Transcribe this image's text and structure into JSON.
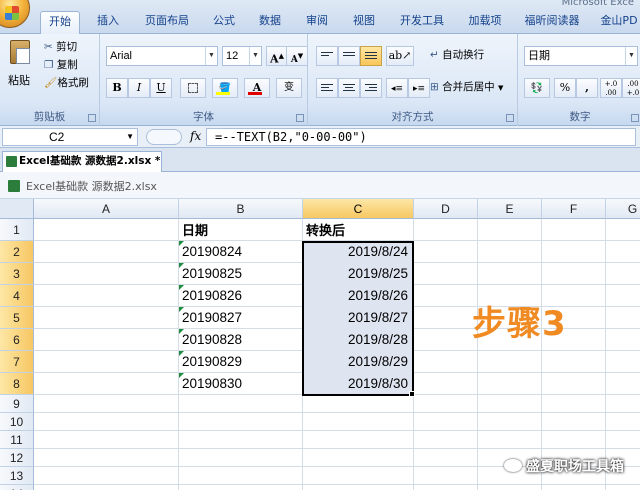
{
  "titlebar": {
    "app_title": "Microsoft Exce"
  },
  "ribbon_tabs": [
    {
      "label": "开始",
      "active": true
    },
    {
      "label": "插入"
    },
    {
      "label": "页面布局"
    },
    {
      "label": "公式"
    },
    {
      "label": "数据"
    },
    {
      "label": "审阅"
    },
    {
      "label": "视图"
    },
    {
      "label": "开发工具"
    },
    {
      "label": "加载项"
    },
    {
      "label": "福昕阅读器"
    },
    {
      "label": "金山PD"
    }
  ],
  "clipboard": {
    "paste": "粘贴",
    "cut": "剪切",
    "copy": "复制",
    "format_painter": "格式刷",
    "group": "剪贴板"
  },
  "font": {
    "name": "Arial",
    "size": "12",
    "grow": "A",
    "shrink": "A",
    "bold": "B",
    "italic": "I",
    "underline": "U",
    "font_color": "A",
    "phonetic": "变",
    "group": "字体"
  },
  "alignment": {
    "wrap_text": "自动换行",
    "merge_center": "合并后居中",
    "group": "对齐方式"
  },
  "number": {
    "format": "日期",
    "percent": "%",
    "comma": ",",
    "inc_decimal": "+.0 .00",
    "dec_decimal": ".00 +.0",
    "group": "数字"
  },
  "formula_bar": {
    "cell_ref": "C2",
    "fx": "fx",
    "formula": "=--TEXT(B2,\"0-00-00\")"
  },
  "workbook": {
    "tab_title": "Excel基础款 源数据2.xlsx *",
    "window_title": "Excel基础款 源数据2.xlsx"
  },
  "grid": {
    "columns": [
      "A",
      "B",
      "C",
      "D",
      "E",
      "F",
      "G"
    ],
    "selected_column": "C",
    "rows": [
      "1",
      "2",
      "3",
      "4",
      "5",
      "6",
      "7",
      "8",
      "9",
      "10",
      "11",
      "12",
      "13",
      "14"
    ],
    "headers": {
      "b1": "日期",
      "c1": "转换后"
    },
    "dates_b": [
      "20190824",
      "20190825",
      "20190826",
      "20190827",
      "20190828",
      "20190829",
      "20190830"
    ],
    "converted_c": [
      "2019/8/24",
      "2019/8/25",
      "2019/8/26",
      "2019/8/27",
      "2019/8/28",
      "2019/8/29",
      "2019/8/30"
    ]
  },
  "annotation": {
    "step": "步骤3",
    "watermark": "盛夏职场工具箱",
    "step_color": "#f08a22"
  }
}
